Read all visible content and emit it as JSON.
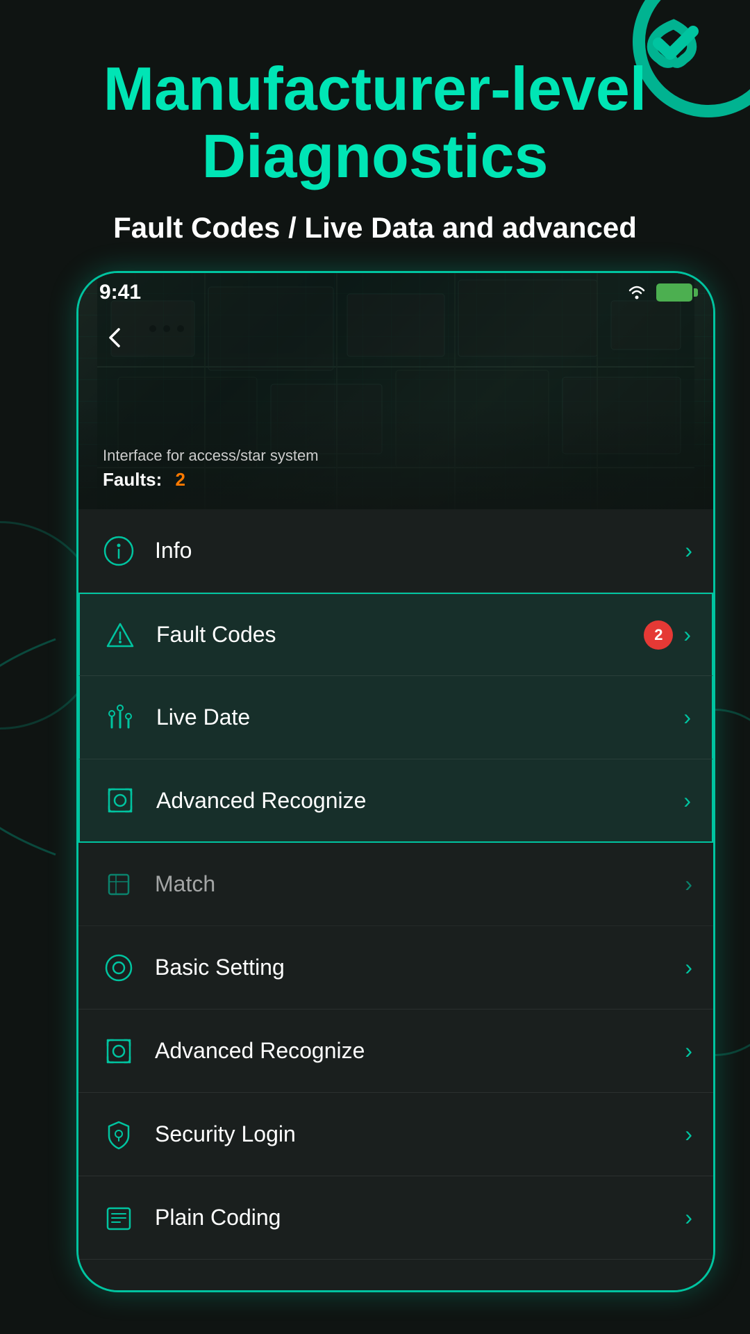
{
  "page": {
    "background_color": "#0f1412"
  },
  "header": {
    "main_title": "Manufacturer-level Diagnostics",
    "subtitle": "Fault Codes / Live Data and advanced"
  },
  "status_bar": {
    "time": "9:41",
    "wifi": "wifi",
    "battery": "battery"
  },
  "phone_content": {
    "interface_label": "Interface for access/star system",
    "faults_label": "Faults:",
    "faults_count": "2",
    "back_button": "‹"
  },
  "menu_items": [
    {
      "id": "info",
      "label": "Info",
      "icon": "info",
      "badge": null,
      "highlighted": false
    },
    {
      "id": "fault-codes",
      "label": "Fault Codes",
      "icon": "alert-triangle",
      "badge": "2",
      "highlighted": true,
      "highlight_position": "top"
    },
    {
      "id": "live-date",
      "label": "Live Date",
      "icon": "bar-chart",
      "badge": null,
      "highlighted": true,
      "highlight_position": "mid"
    },
    {
      "id": "advanced-recognize-1",
      "label": "Advanced Recognize",
      "icon": "scan",
      "badge": null,
      "highlighted": true,
      "highlight_position": "bottom"
    },
    {
      "id": "match",
      "label": "Match",
      "icon": "box",
      "badge": null,
      "highlighted": false,
      "faded": true
    },
    {
      "id": "basic-setting",
      "label": "Basic Setting",
      "icon": "settings-circle",
      "badge": null,
      "highlighted": false
    },
    {
      "id": "advanced-recognize-2",
      "label": "Advanced Recognize",
      "icon": "scan",
      "badge": null,
      "highlighted": false
    },
    {
      "id": "security-login",
      "label": "Security Login",
      "icon": "shield",
      "badge": null,
      "highlighted": false
    },
    {
      "id": "plain-coding",
      "label": "Plain Coding",
      "icon": "list",
      "badge": null,
      "highlighted": false
    }
  ],
  "colors": {
    "accent": "#00c4a0",
    "accent_light": "#00e5b5",
    "background": "#0f1412",
    "surface": "#1a1f1e",
    "text_primary": "#ffffff",
    "text_secondary": "#cccccc",
    "fault_count": "#ff7a00",
    "badge_bg": "#e53935",
    "chevron": "#00c4a0"
  }
}
